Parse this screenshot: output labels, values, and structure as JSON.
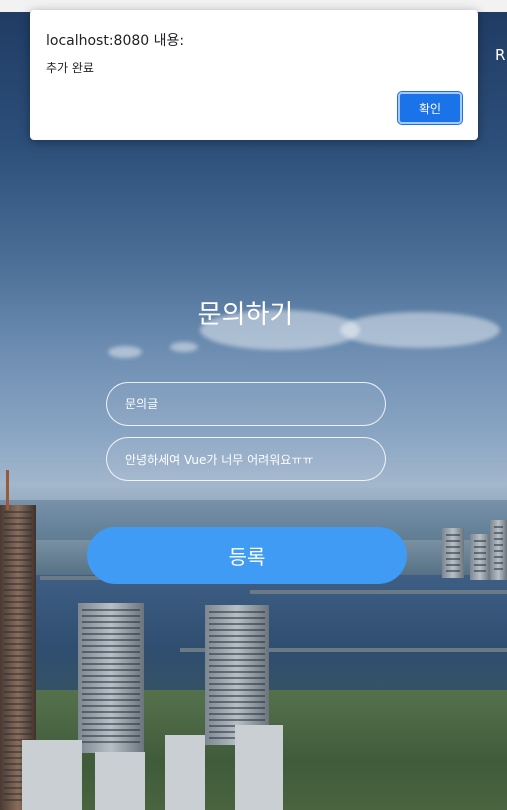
{
  "dialog": {
    "title": "localhost:8080 내용:",
    "message": "추가 완료",
    "ok_label": "확인"
  },
  "header": {
    "corner_text": "R"
  },
  "form": {
    "title": "문의하기",
    "subject_placeholder": "문의글",
    "content_value": "안녕하세여 Vue가 너무 어려워요ㅠㅠ",
    "submit_label": "등록",
    "submit_color": "#3f9bf4"
  }
}
